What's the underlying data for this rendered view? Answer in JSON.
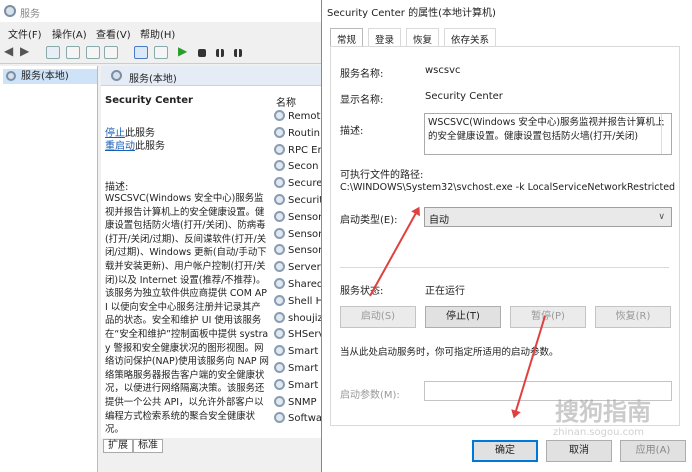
{
  "services_window": {
    "title": "服务",
    "menu": [
      "文件(F)",
      "操作(A)",
      "查看(V)",
      "帮助(H)"
    ],
    "tree_item": "服务(本地)",
    "panel_header": "服务(本地)",
    "selected_service_name": "Security Center",
    "stop_link": "停止",
    "stop_suffix": "此服务",
    "restart_link": "重启动",
    "restart_suffix": "此服务",
    "description_label": "描述:",
    "description_text": "WSCSVC(Windows 安全中心)服务监视并报告计算机上的安全健康设置。健康设置包括防火墙(打开/关闭)、防病毒(打开/关闭/过期)、反间谍软件(打开/关闭/过期)、Windows 更新(自动/手动下载并安装更新)、用户帐户控制(打开/关闭)以及 Internet 设置(推荐/不推荐)。该服务为独立软件供应商提供 COM API 以便向安全中心服务注册并记录其产品的状态。安全和维护 UI 使用该服务在“安全和维护”控制面板中提供 systray 警报和安全健康状况的图形视图。网络访问保护(NAP)使用该服务向 NAP 网络策略服务器报告客户端的安全健康状况，以便进行网络隔离决策。该服务还提供一个公共 API，以允许外部客户以编程方式检索系统的聚合安全健康状况。",
    "list_header": "名称",
    "service_list": [
      "Remot",
      "Routin",
      "RPC Er",
      "Secon",
      "Secure",
      "Securit",
      "Sensor",
      "Sensor",
      "Sensor",
      "Server",
      "Shared",
      "Shell H",
      "shoujiz",
      "SHServ",
      "Smart",
      "Smart",
      "Smart",
      "SNMP",
      "Softwa"
    ],
    "bottom_tabs": [
      "扩展",
      "标准"
    ]
  },
  "dialog": {
    "title": "Security Center 的属性(本地计算机)",
    "tabs": [
      "常规",
      "登录",
      "恢复",
      "依存关系"
    ],
    "service_name_label": "服务名称:",
    "service_name_value": "wscsvc",
    "display_name_label": "显示名称:",
    "display_name_value": "Security Center",
    "description_label": "描述:",
    "description_value": "WSCSVC(Windows 安全中心)服务监视并报告计算机上的安全健康设置。健康设置包括防火墙(打开/关闭)",
    "exe_path_label": "可执行文件的路径:",
    "exe_path_value": "C:\\WINDOWS\\System32\\svchost.exe -k LocalServiceNetworkRestricted",
    "startup_type_label": "启动类型(E):",
    "startup_type_value": "自动",
    "service_status_label": "服务状态:",
    "service_status_value": "正在运行",
    "buttons": {
      "start": "启动(S)",
      "stop": "停止(T)",
      "pause": "暂停(P)",
      "resume": "恢复(R)"
    },
    "hint_text": "当从此处启动服务时，你可指定所适用的启动参数。",
    "start_params_label": "启动参数(M):",
    "ok": "确定",
    "cancel": "取消",
    "apply": "应用(A)"
  },
  "watermark": {
    "text": "搜狗指南",
    "url": "zhinan.sogou.com"
  },
  "colors": {
    "annotation_arrow": "#e04040",
    "link": "#1a5fb4",
    "primary_border": "#0078d7"
  }
}
